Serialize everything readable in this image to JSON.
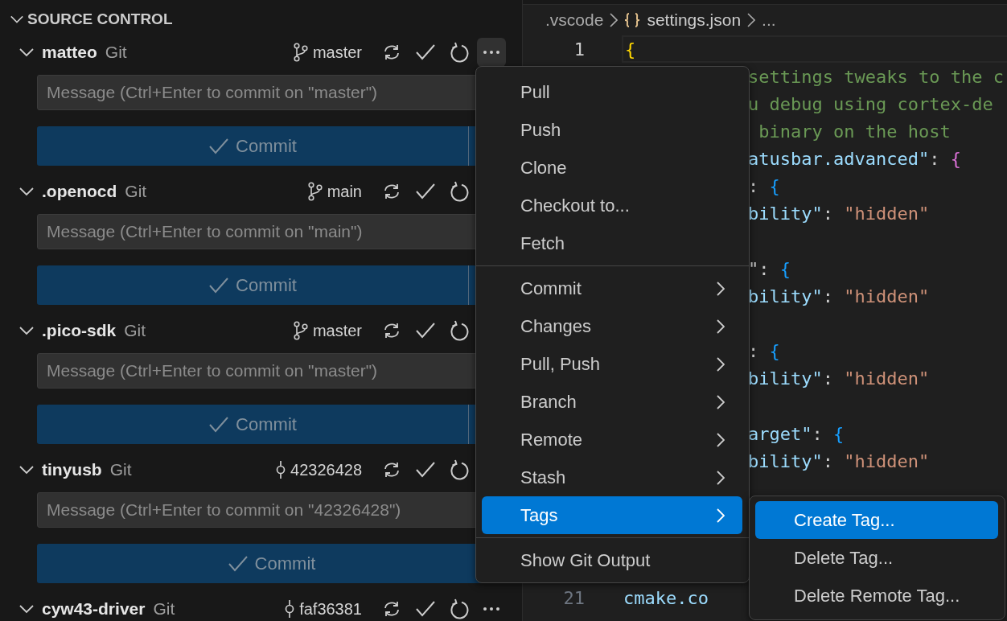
{
  "source_control": {
    "title": "SOURCE CONTROL",
    "expanded": true,
    "repositories": [
      {
        "name": "matteo",
        "provider": "Git",
        "ref": {
          "kind": "branch",
          "label": "master"
        },
        "more_hovered": true,
        "expanded": true,
        "message": {
          "placeholder": "Message (Ctrl+Enter to commit on \"master\")"
        },
        "commit": {
          "label": "Commit",
          "disabled": true,
          "split": true
        }
      },
      {
        "name": ".openocd",
        "provider": "Git",
        "ref": {
          "kind": "branch",
          "label": "main"
        },
        "more_hovered": false,
        "expanded": true,
        "message": {
          "placeholder": "Message (Ctrl+Enter to commit on \"main\")"
        },
        "commit": {
          "label": "Commit",
          "disabled": true,
          "split": true
        }
      },
      {
        "name": ".pico-sdk",
        "provider": "Git",
        "ref": {
          "kind": "branch",
          "label": "master"
        },
        "more_hovered": false,
        "expanded": true,
        "message": {
          "placeholder": "Message (Ctrl+Enter to commit on \"master\")"
        },
        "commit": {
          "label": "Commit",
          "disabled": true,
          "split": true
        }
      },
      {
        "name": "tinyusb",
        "provider": "Git",
        "ref": {
          "kind": "commit",
          "label": "42326428"
        },
        "more_hovered": false,
        "expanded": true,
        "message": {
          "placeholder": "Message (Ctrl+Enter to commit on \"42326428\")"
        },
        "commit": {
          "label": "Commit",
          "disabled": true,
          "split": false
        }
      },
      {
        "name": "cyw43-driver",
        "provider": "Git",
        "ref": {
          "kind": "commit",
          "label": "faf36381"
        },
        "more_hovered": false,
        "expanded": true
      }
    ]
  },
  "editor": {
    "breadcrumb": [
      {
        "kind": "folder",
        "label": ".vscode"
      },
      {
        "kind": "json",
        "label": "settings.json"
      },
      {
        "kind": "more",
        "label": "..."
      }
    ],
    "blocks": [
      [
        {
          "number": "1",
          "covered": false,
          "current": true,
          "tokens": [
            {
              "kind": "brace1",
              "text": "{"
            }
          ]
        },
        {
          "covered": true,
          "tokens": [
            {
              "kind": "comment",
              "text": "settings tweaks to the c"
            }
          ]
        },
        {
          "covered": true,
          "tokens": [
            {
              "kind": "comment",
              "text": "u debug using cortex-de"
            }
          ]
        },
        {
          "covered": true,
          "tokens": [
            {
              "kind": "comment",
              "text": " binary on the host"
            }
          ]
        },
        {
          "covered": true,
          "tokens": [
            {
              "kind": "key",
              "text": "atusbar.advanced\""
            },
            {
              "kind": "punct",
              "text": ": "
            },
            {
              "kind": "brace2",
              "text": "{"
            }
          ]
        },
        {
          "covered": true,
          "tokens": [
            {
              "kind": "punct",
              "text": ": "
            },
            {
              "kind": "brace3",
              "text": "{"
            }
          ]
        },
        {
          "covered": true,
          "tokens": [
            {
              "kind": "key",
              "text": "bility\""
            },
            {
              "kind": "punct",
              "text": ": "
            },
            {
              "kind": "string",
              "text": "\"hidden\""
            }
          ]
        }
      ],
      [
        {
          "covered": true,
          "tokens": [
            {
              "kind": "punct",
              "text": "\": "
            },
            {
              "kind": "brace3",
              "text": "{"
            }
          ]
        },
        {
          "covered": true,
          "tokens": [
            {
              "kind": "key",
              "text": "bility\""
            },
            {
              "kind": "punct",
              "text": ": "
            },
            {
              "kind": "string",
              "text": "\"hidden\""
            }
          ]
        }
      ],
      [
        {
          "covered": true,
          "tokens": [
            {
              "kind": "punct",
              "text": ": "
            },
            {
              "kind": "brace3",
              "text": "{"
            }
          ]
        },
        {
          "covered": true,
          "tokens": [
            {
              "kind": "key",
              "text": "bility\""
            },
            {
              "kind": "punct",
              "text": ": "
            },
            {
              "kind": "string",
              "text": "\"hidden\""
            }
          ]
        }
      ],
      [
        {
          "covered": true,
          "tokens": [
            {
              "kind": "key",
              "text": "arget\""
            },
            {
              "kind": "punct",
              "text": ": "
            },
            {
              "kind": "brace3",
              "text": "{"
            }
          ]
        },
        {
          "covered": true,
          "tokens": [
            {
              "kind": "key",
              "text": "bility\""
            },
            {
              "kind": "punct",
              "text": ": "
            },
            {
              "kind": "string",
              "text": "\"hidden\""
            }
          ]
        }
      ],
      [
        {
          "number": "21",
          "covered": false,
          "current": false,
          "tokens": [
            {
              "kind": "key",
              "text": "cmake.co"
            }
          ]
        }
      ]
    ]
  },
  "context_menu": {
    "groups": [
      [
        {
          "label": "Pull",
          "submenu": false,
          "selected": false
        },
        {
          "label": "Push",
          "submenu": false,
          "selected": false
        },
        {
          "label": "Clone",
          "submenu": false,
          "selected": false
        },
        {
          "label": "Checkout to...",
          "submenu": false,
          "selected": false
        },
        {
          "label": "Fetch",
          "submenu": false,
          "selected": false
        }
      ],
      [
        {
          "label": "Commit",
          "submenu": true,
          "selected": false
        },
        {
          "label": "Changes",
          "submenu": true,
          "selected": false
        },
        {
          "label": "Pull, Push",
          "submenu": true,
          "selected": false
        },
        {
          "label": "Branch",
          "submenu": true,
          "selected": false
        },
        {
          "label": "Remote",
          "submenu": true,
          "selected": false
        },
        {
          "label": "Stash",
          "submenu": true,
          "selected": false
        },
        {
          "label": "Tags",
          "submenu": true,
          "selected": true
        }
      ],
      [
        {
          "label": "Show Git Output",
          "submenu": false,
          "selected": false
        }
      ]
    ]
  },
  "submenu": {
    "items": [
      {
        "label": "Create Tag...",
        "selected": true
      },
      {
        "label": "Delete Tag...",
        "selected": false
      },
      {
        "label": "Delete Remote Tag...",
        "selected": false
      }
    ]
  }
}
